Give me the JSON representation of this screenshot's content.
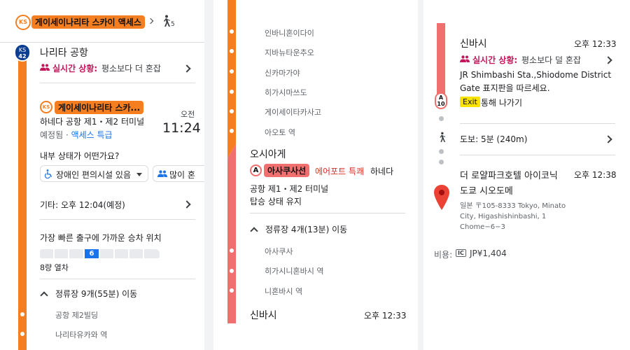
{
  "panel1": {
    "header": {
      "badge": "KS",
      "title": "게이세이나리타 스카이 액세스",
      "walk_count": "5"
    },
    "origin": {
      "badge_top": "KS",
      "badge_num": "42",
      "name": "나리타 공항",
      "status_label": "실시간 상황:",
      "status_text": "평소보다 더 혼잡"
    },
    "train": {
      "badge": "KS",
      "line_name": "게이세이나리타 스카...",
      "destination": "하네다 공항 제1・제2 터미널",
      "scheduled": "예정됨",
      "service": "액세스 특급",
      "ampm": "오전",
      "time": "11:24"
    },
    "condition": {
      "question": "내부 상태가 어떤가요?",
      "accessibility_chip": "장애인 편의시설 있음",
      "crowd_chip": "많이 혼"
    },
    "other": {
      "text": "기타: 오후 12:04(예정)"
    },
    "exit_pos": {
      "title": "가장 빠른 출구에 가까운 승차 위치",
      "car_number": "6",
      "cars_label": "8량 열차"
    },
    "stops": {
      "title": "정류장 9개(55분) 이동",
      "items": [
        "공항 제2빌딩",
        "나리타유카와 역"
      ]
    }
  },
  "panel2": {
    "stops_top": [
      "인바니혼이다이",
      "지바뉴타운추오",
      "신카마가야",
      "히가시마쓰도",
      "게이세이타카사고",
      "아오토 역"
    ],
    "transfer": {
      "station": "오시아게",
      "line_letter": "A",
      "line_name": "아사쿠사선",
      "service": "에어포트 특쾌",
      "direction": "하네다",
      "destination": "공항 제1・제2 터미널",
      "note": "탑승 상태 유지"
    },
    "stops": {
      "title": "정류장 4개(13분) 이동",
      "items": [
        "아사쿠사",
        "히가시니혼바시 역",
        "니혼바시 역"
      ]
    },
    "arrival": {
      "station": "신바시",
      "time": "오후 12:33"
    }
  },
  "panel3": {
    "arrival": {
      "station": "신바시",
      "time": "오후 12:33",
      "status_label": "실시간 상황:",
      "status_text": "평소보다 덜 혼잡",
      "instruction": "JR Shimbashi Sta.,Shiodome District Gate 표지판을 따르세요.",
      "exit_label": "Exit",
      "exit_text": "통해 나가기",
      "badge_letter": "A",
      "badge_num": "10"
    },
    "walk": {
      "text": "도보: 5분 (240m)"
    },
    "destination": {
      "name_line1": "더 로얄파크호텔 아이코닉",
      "name_line2": "도쿄 시오도메",
      "time": "오후 12:38",
      "address": "일본 〒105-8333 Tokyo, Minato City, Higashishinbashi, 1 Chome−6−3"
    },
    "fare": {
      "label": "비용:",
      "ic": "IC",
      "amount": "JP¥1,404"
    }
  },
  "colors": {
    "keisei_orange": "#f57f20",
    "asakusa_pink": "#f07070",
    "status_magenta": "#c2185b",
    "link_blue": "#1a73e8",
    "badge_navy": "#0b3d91",
    "pin_red": "#ea4335"
  }
}
